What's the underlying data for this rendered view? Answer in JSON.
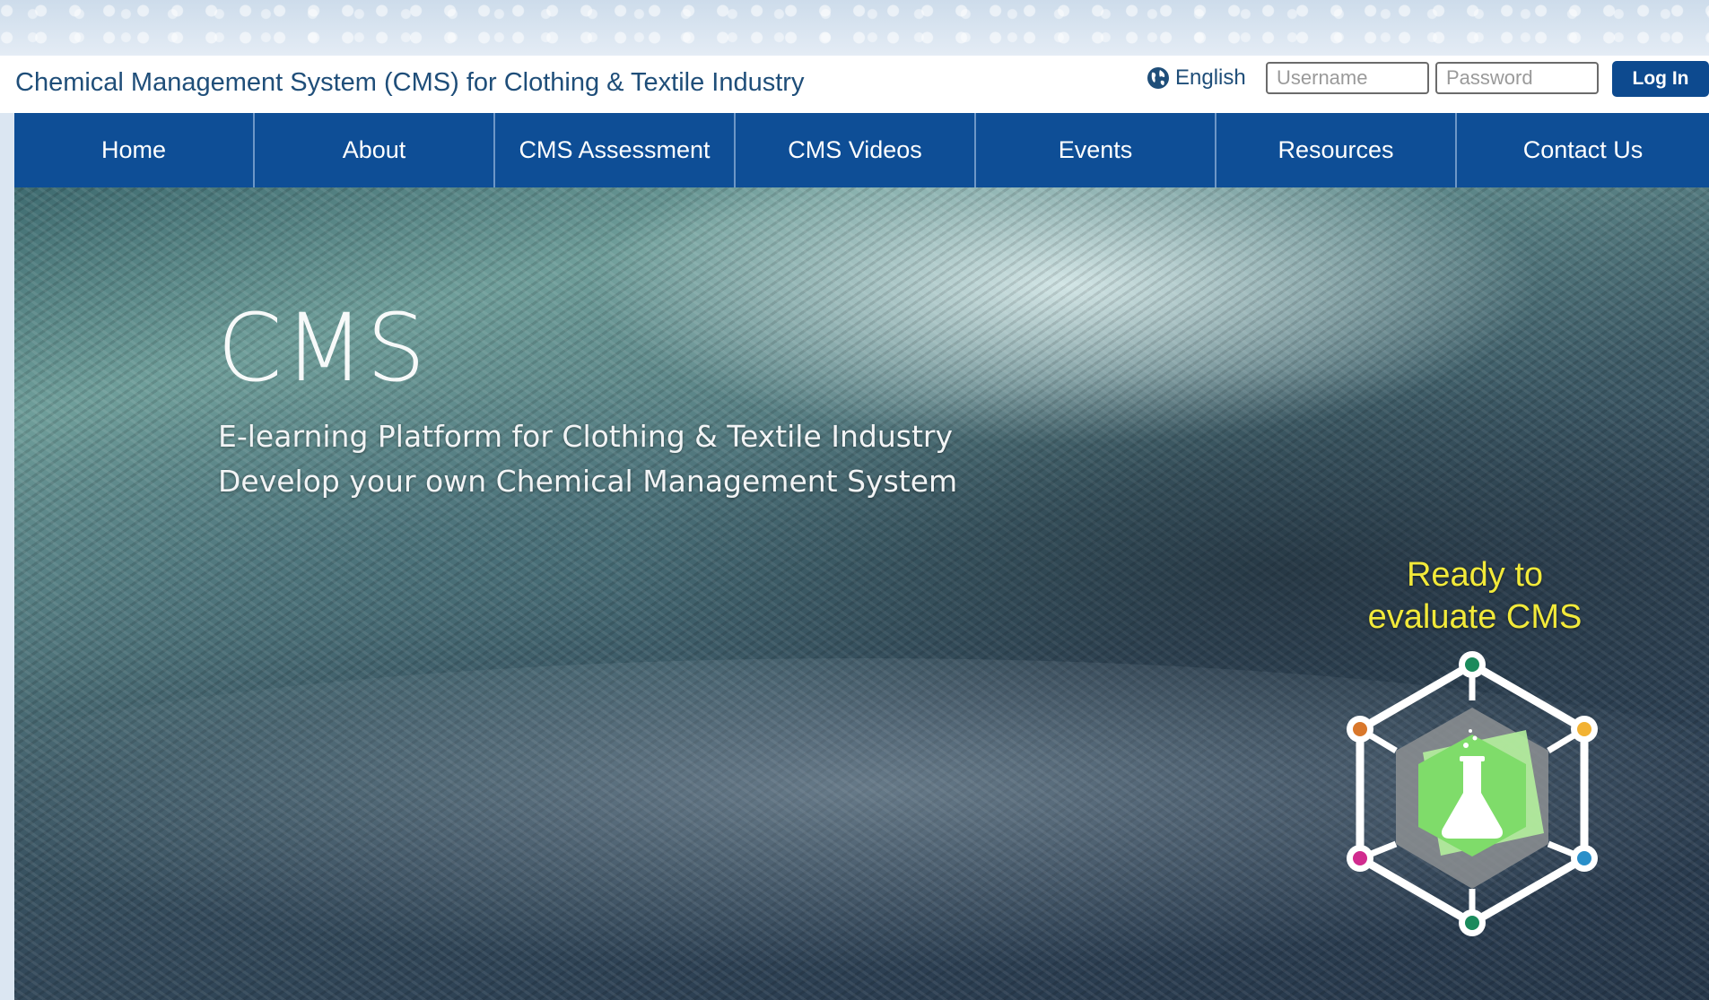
{
  "header": {
    "site_title": "Chemical Management System (CMS) for Clothing & Textile Industry",
    "language_label": "English",
    "username_placeholder": "Username",
    "password_placeholder": "Password",
    "login_label": "Log In"
  },
  "nav": {
    "items": [
      {
        "label": "Home"
      },
      {
        "label": "About"
      },
      {
        "label": "CMS Assessment"
      },
      {
        "label": "CMS Videos"
      },
      {
        "label": "Events"
      },
      {
        "label": "Resources"
      },
      {
        "label": "Contact Us"
      }
    ]
  },
  "hero": {
    "title": "CMS",
    "subtitle_line1": "E-learning Platform for Clothing & Textile Industry",
    "subtitle_line2": "Develop your own Chemical Management System",
    "cta_line1": "Ready to",
    "cta_line2": "evaluate CMS"
  },
  "icons": {
    "language": "globe-icon",
    "assessment_logo": "flask-hexagon-icon"
  },
  "colors": {
    "nav_background": "#0e4e96",
    "title_text": "#1f4e79",
    "cta_text": "#f2ea3a",
    "logo_green": "#8ee87a"
  }
}
